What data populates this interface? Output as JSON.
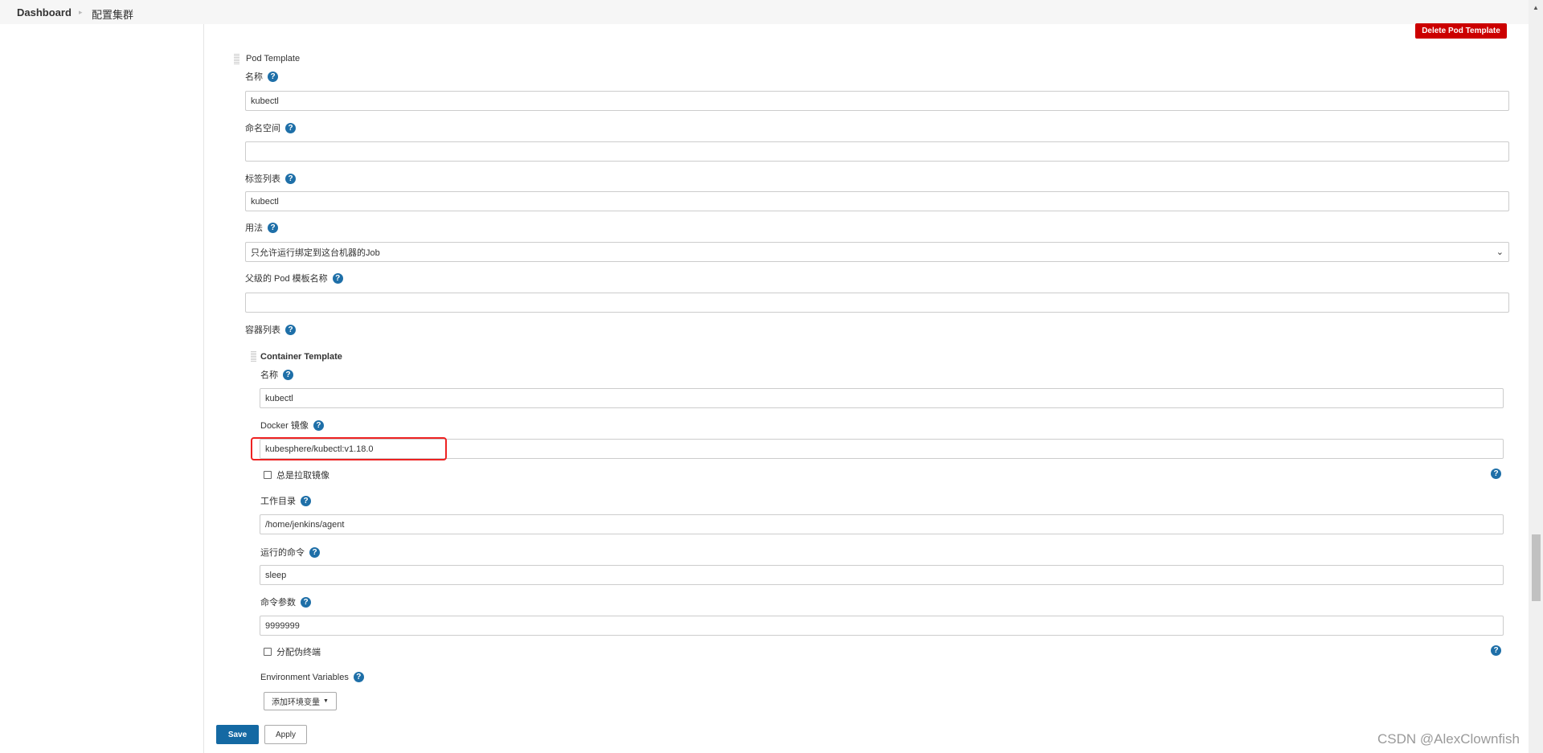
{
  "breadcrumb": {
    "home": "Dashboard",
    "current": "配置集群"
  },
  "delete_button": "Delete Pod Template",
  "pod_template": {
    "title": "Pod Template",
    "name_label": "名称",
    "name_value": "kubectl",
    "namespace_label": "命名空间",
    "namespace_value": "",
    "labels_label": "标签列表",
    "labels_value": "kubectl",
    "usage_label": "用法",
    "usage_value": "只允许运行绑定到这台机器的Job",
    "parent_label": "父级的 Pod 模板名称",
    "parent_value": "",
    "containers_label": "容器列表"
  },
  "container_template": {
    "title": "Container Template",
    "name_label": "名称",
    "name_value": "kubectl",
    "image_label": "Docker 镜像",
    "image_value": "kubesphere/kubectl:v1.18.0",
    "always_pull_label": "总是拉取镜像",
    "workdir_label": "工作目录",
    "workdir_value": "/home/jenkins/agent",
    "command_label": "运行的命令",
    "command_value": "sleep",
    "args_label": "命令参数",
    "args_value": "9999999",
    "tty_label": "分配伪终端",
    "env_label": "Environment Variables",
    "add_env_button": "添加环境变量"
  },
  "footer": {
    "save": "Save",
    "apply": "Apply"
  },
  "watermark": "CSDN @AlexClownfish",
  "colors": {
    "delete": "#cc0000",
    "save": "#1469a3",
    "highlight": "#ee2222",
    "help": "#1e6fa8"
  },
  "scroll_position_percent": 80
}
